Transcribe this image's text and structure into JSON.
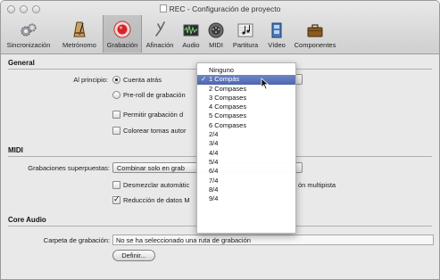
{
  "window": {
    "title": "REC - Configuración de proyecto"
  },
  "toolbar": {
    "items": [
      {
        "label": "Sincronización",
        "icon": "gears-icon"
      },
      {
        "label": "Metrónomo",
        "icon": "metronome-icon"
      },
      {
        "label": "Grabación",
        "icon": "record-icon",
        "selected": true
      },
      {
        "label": "Afinación",
        "icon": "tuning-fork-icon"
      },
      {
        "label": "Audio",
        "icon": "audio-waveform-icon"
      },
      {
        "label": "MIDI",
        "icon": "midi-port-icon"
      },
      {
        "label": "Partitura",
        "icon": "score-notes-icon"
      },
      {
        "label": "Vídeo",
        "icon": "video-film-icon"
      },
      {
        "label": "Componentes",
        "icon": "briefcase-icon"
      }
    ]
  },
  "general": {
    "header": "General",
    "start_label": "Al principio:",
    "count_in_option": "Cuenta atrás",
    "preroll_option": "Pre-roll de grabación",
    "allow_recording_option": "Permitir grabación d",
    "color_takes_option": "Colorear tomas autor"
  },
  "midi": {
    "header": "MIDI",
    "overlap_label": "Grabaciones superpuestas:",
    "overlap_value": "Combinar solo en grab",
    "demix_option": "Desmezclar automátic",
    "demix_suffix": "ón multipista",
    "reduction_option": "Reducción de datos M"
  },
  "core_audio": {
    "header": "Core Audio",
    "folder_label": "Carpeta de grabación:",
    "folder_value": "No se ha seleccionado una ruta de grabación",
    "define_button": "Definir..."
  },
  "count_in_menu": {
    "items": [
      "Ninguno",
      "1 Compás",
      "2 Compases",
      "3 Compases",
      "4 Compases",
      "5 Compases",
      "6 Compases",
      "2/4",
      "3/4",
      "4/4",
      "5/4",
      "6/4",
      "7/4",
      "8/4",
      "9/4"
    ],
    "selected": "1 Compás",
    "check_mark": "✓"
  },
  "colors": {
    "menu_highlight": "#5a72b8",
    "record_red": "#d8222a"
  }
}
